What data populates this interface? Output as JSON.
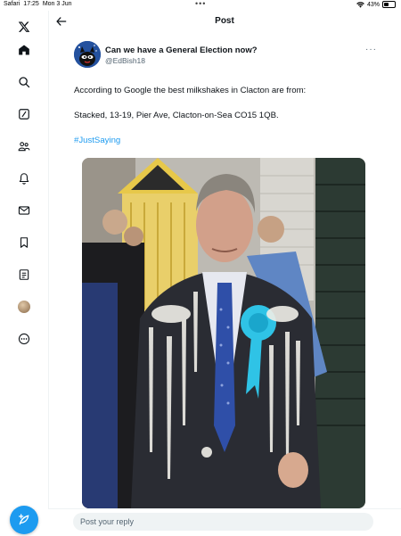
{
  "status_bar": {
    "app": "Safari",
    "time": "17:25",
    "date": "Mon 3 Jun",
    "dots": "•••",
    "battery": "43%",
    "battery_level": 0.43
  },
  "header": {
    "title": "Post"
  },
  "sidebar": {
    "items": [
      {
        "name": "x-logo-icon"
      },
      {
        "name": "home-icon"
      },
      {
        "name": "search-icon"
      },
      {
        "name": "grok-icon"
      },
      {
        "name": "communities-icon"
      },
      {
        "name": "notifications-icon"
      },
      {
        "name": "messages-icon"
      },
      {
        "name": "bookmarks-icon"
      },
      {
        "name": "lists-icon"
      },
      {
        "name": "profile-avatar"
      },
      {
        "name": "more-icon"
      }
    ]
  },
  "post": {
    "author_name": "Can we have a General Election now?",
    "author_handle": "@EdBish18",
    "more_label": "···",
    "text_line1": "According to Google the best milkshakes in Clacton are from:",
    "text_line2": "Stacked, 13-19, Pier Ave, Clacton-on-Sea CO15 1QB.",
    "hashtag": "#JustSaying"
  },
  "reply": {
    "placeholder": "Post your reply"
  },
  "colors": {
    "accent": "#1d9bf0",
    "text": "#0f1419",
    "muted": "#536471"
  }
}
